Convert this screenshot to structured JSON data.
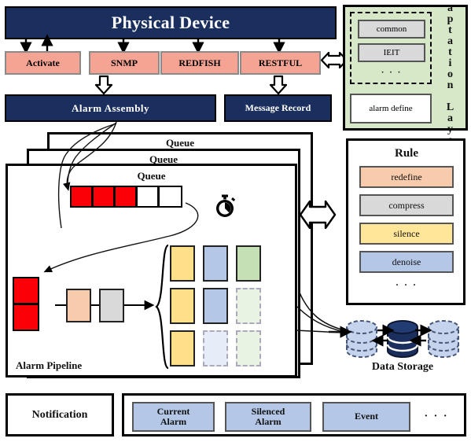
{
  "physical_device": {
    "label": "Physical Device"
  },
  "protocols": [
    {
      "label": "Activate",
      "name": "protocol-activate"
    },
    {
      "label": "SNMP",
      "name": "protocol-snmp"
    },
    {
      "label": "REDFISH",
      "name": "protocol-redfish"
    },
    {
      "label": "RESTFUL",
      "name": "protocol-restful"
    }
  ],
  "assembly": {
    "label": "Alarm  Assembly"
  },
  "message_record": {
    "label": "Message Record"
  },
  "adaptation_layer": {
    "title": "Adaptation Layer",
    "drivers": [
      {
        "label": "common"
      },
      {
        "label": "IEIT"
      }
    ],
    "ellipsis": "· · ·",
    "alarm_define": "alarm define"
  },
  "rule_panel": {
    "title": "Rule",
    "rules": [
      {
        "label": "redefine",
        "color": "#f8cbad"
      },
      {
        "label": "compress",
        "color": "#d9d9d9"
      },
      {
        "label": "silence",
        "color": "#ffe699"
      },
      {
        "label": "denoise",
        "color": "#b4c7e7"
      }
    ],
    "ellipsis": "· · ·"
  },
  "pipeline": {
    "queue_labels": [
      "Queue",
      "Queue",
      "Queue"
    ],
    "title": "Alarm Pipeline",
    "queue_cells": [
      "red",
      "red",
      "red",
      "white",
      "white"
    ],
    "timer_icon": "stopwatch-icon",
    "input_stack": [
      "red",
      "red"
    ],
    "stages": [
      {
        "name": "stage-redefine",
        "color": "#f8cbad"
      },
      {
        "name": "stage-compress",
        "color": "#d9d9d9"
      }
    ],
    "output_grid": [
      [
        "solid-yellow",
        "solid-blue",
        "solid-green"
      ],
      [
        "solid-yellow",
        "solid-blue",
        "faded-green"
      ],
      [
        "solid-yellow",
        "faded-blue",
        "faded-green"
      ]
    ]
  },
  "data_storage": {
    "title": "Data Storage",
    "nodes": [
      {
        "name": "db-replica-left",
        "style": "dashed-light"
      },
      {
        "name": "db-primary",
        "style": "solid-dark"
      },
      {
        "name": "db-replica-right",
        "style": "dashed-light"
      }
    ]
  },
  "notification": {
    "label": "Notification"
  },
  "outputs": {
    "items": [
      {
        "label": "Current\nAlarm",
        "line1": "Current",
        "line2": "Alarm"
      },
      {
        "label": "Silenced\nAlarm",
        "line1": "Silenced",
        "line2": "Alarm"
      },
      {
        "label": "Event",
        "line1": "Event",
        "line2": ""
      }
    ],
    "ellipsis": "· · ·"
  },
  "colors": {
    "navy": "#1b2f5e",
    "salmon": "#f5a493",
    "green_panel": "#d6e8c8",
    "alarm_red": "#fb0007"
  }
}
